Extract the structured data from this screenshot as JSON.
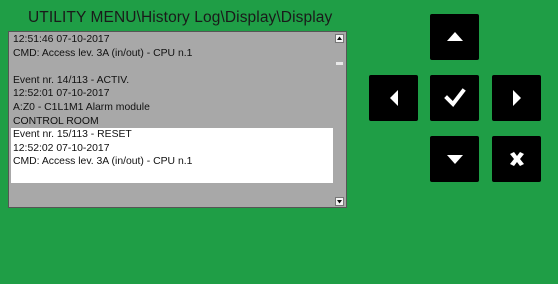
{
  "window": {
    "title": "UTILITY MENU\\History Log\\Display\\Display"
  },
  "log": {
    "lines": [
      {
        "text": "12:51:46 07-10-2017",
        "selected": false
      },
      {
        "text": "CMD: Access lev. 3A (in/out) - CPU n.1",
        "selected": false
      },
      {
        "text": "",
        "selected": false
      },
      {
        "text": "Event nr. 14/113 - ACTIV.",
        "selected": false
      },
      {
        "text": "12:52:01 07-10-2017",
        "selected": false
      },
      {
        "text": "A:Z0 - C1L1M1 Alarm module",
        "selected": false
      },
      {
        "text": "CONTROL ROOM",
        "selected": false
      },
      {
        "text": "Event nr. 15/113 - RESET",
        "selected": true
      },
      {
        "text": "12:52:02 07-10-2017",
        "selected": true
      },
      {
        "text": "CMD: Access lev. 3A (in/out) - CPU n.1",
        "selected": true
      },
      {
        "text": "",
        "selected": true
      }
    ]
  },
  "icons": {
    "scroll_up": "scroll-up-arrow-icon",
    "scroll_down": "scroll-down-arrow-icon",
    "up": "arrow-up-icon",
    "left": "arrow-left-icon",
    "ok": "checkmark-icon",
    "right": "arrow-right-icon",
    "down": "arrow-down-icon",
    "cancel": "cancel-x-icon"
  },
  "colors": {
    "background": "#1f9e46",
    "panel": "#a8a8a8",
    "selection": "#ffffff",
    "button": "#000000",
    "button_icon": "#ffffff"
  }
}
